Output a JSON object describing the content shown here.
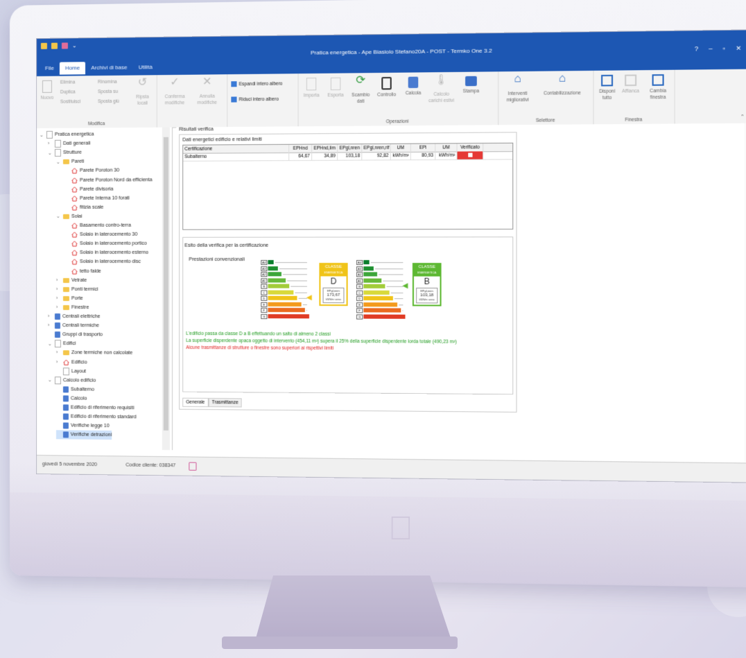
{
  "window": {
    "title": "Pratica energetica - Ape Biasiolo Stefano20A - POST - Termko One 3.2",
    "controls": [
      "?",
      "–",
      "▫",
      "✕"
    ]
  },
  "tabs": [
    "File",
    "Home",
    "Archivi di base",
    "Utilità"
  ],
  "ribbon": {
    "modifica": {
      "label": "Modifica",
      "nuovo": "Nuovo",
      "elimina": "Elimina",
      "duplica": "Duplica",
      "sostituisci": "Sostituisci",
      "rinomina": "Rinomina",
      "sposta_su": "Sposta su",
      "sposta_giu": "Sposta giù",
      "ripristina_locali": "Ripsta locali",
      "conferma_modifiche": "Conferma modifiche",
      "annulla_modifiche": "Annulla modifiche"
    },
    "albero": {
      "espandi": "Espandi intero albero",
      "riduci": "Riduci intero albero"
    },
    "operazioni": {
      "label": "Operazioni",
      "importa": "Importa",
      "esporta": "Esporta",
      "scambio_dati": "Scambio dati",
      "controllo": "Controllo",
      "calcola": "Calcola",
      "calcolo_carichi": "Calcolo carichi estivi",
      "stampa": "Stampa"
    },
    "selettore": {
      "label": "Selettore",
      "interventi": "Interventi migliorativi",
      "contabilizzazione": "Contabilizzazione"
    },
    "finestra": {
      "label": "Finestra",
      "disponi": "Disponi tutto",
      "affianca": "Affianca",
      "cambia": "Cambia finestra"
    }
  },
  "tree": [
    {
      "label": "Pratica energetica",
      "indent": 0,
      "icon": "doc",
      "chev": "v"
    },
    {
      "label": "Dati generali",
      "indent": 1,
      "icon": "doc",
      "chev": ">"
    },
    {
      "label": "Strutture",
      "indent": 1,
      "icon": "doc",
      "chev": "v"
    },
    {
      "label": "Pareti",
      "indent": 2,
      "icon": "folder",
      "chev": "v"
    },
    {
      "label": "Parete Poroton 30",
      "indent": 3,
      "icon": "house",
      "chev": ""
    },
    {
      "label": "Parete Poroton Nord da efficienta",
      "indent": 3,
      "icon": "house",
      "chev": ""
    },
    {
      "label": "Parete divisoria",
      "indent": 3,
      "icon": "house",
      "chev": ""
    },
    {
      "label": "Parete Interna 10 forati",
      "indent": 3,
      "icon": "house",
      "chev": ""
    },
    {
      "label": "fitizia scale",
      "indent": 3,
      "icon": "house",
      "chev": ""
    },
    {
      "label": "Solai",
      "indent": 2,
      "icon": "folder",
      "chev": "v"
    },
    {
      "label": "Basamento contro-terra",
      "indent": 3,
      "icon": "house",
      "chev": ""
    },
    {
      "label": "Solaio in laterocemento 30",
      "indent": 3,
      "icon": "house",
      "chev": ""
    },
    {
      "label": "Solaio in laterocemento portico",
      "indent": 3,
      "icon": "house",
      "chev": ""
    },
    {
      "label": "Solaio in laterocemento esterno",
      "indent": 3,
      "icon": "house",
      "chev": ""
    },
    {
      "label": "Solaio in laterocemento disc",
      "indent": 3,
      "icon": "house",
      "chev": ""
    },
    {
      "label": "tetto falde",
      "indent": 3,
      "icon": "house",
      "chev": ""
    },
    {
      "label": "Vetrate",
      "indent": 2,
      "icon": "folder",
      "chev": ">"
    },
    {
      "label": "Ponti termici",
      "indent": 2,
      "icon": "folder",
      "chev": ">"
    },
    {
      "label": "Porte",
      "indent": 2,
      "icon": "folder",
      "chev": ">"
    },
    {
      "label": "Finestre",
      "indent": 2,
      "icon": "folder",
      "chev": ">"
    },
    {
      "label": "Centrali elettriche",
      "indent": 1,
      "icon": "calc",
      "chev": ">"
    },
    {
      "label": "Centrali termiche",
      "indent": 1,
      "icon": "calc",
      "chev": ">"
    },
    {
      "label": "Gruppi di trasporto",
      "indent": 1,
      "icon": "calc",
      "chev": ""
    },
    {
      "label": "Edifici",
      "indent": 1,
      "icon": "doc",
      "chev": "v"
    },
    {
      "label": "Zone termiche non calcolate",
      "indent": 2,
      "icon": "folder",
      "chev": ">"
    },
    {
      "label": "Edificio",
      "indent": 2,
      "icon": "house",
      "chev": ">"
    },
    {
      "label": "Layout",
      "indent": 2,
      "icon": "doc",
      "chev": ""
    },
    {
      "label": "Calcolo edificio",
      "indent": 1,
      "icon": "doc",
      "chev": "v"
    },
    {
      "label": "Subalterno",
      "indent": 2,
      "icon": "calc",
      "chev": ""
    },
    {
      "label": "Calcolo",
      "indent": 2,
      "icon": "calc",
      "chev": ""
    },
    {
      "label": "Edificio di riferimento requisiti",
      "indent": 2,
      "icon": "calc",
      "chev": ""
    },
    {
      "label": "Edificio di riferimento standard",
      "indent": 2,
      "icon": "calc",
      "chev": ""
    },
    {
      "label": "Verifiche legge 10",
      "indent": 2,
      "icon": "calc",
      "chev": ""
    },
    {
      "label": "Verifiche detrazioni",
      "indent": 2,
      "icon": "calc",
      "chev": "",
      "selected": true
    }
  ],
  "status": {
    "date": "giovedì 5 novembre 2020",
    "client_code": "Codice cliente: 038347"
  },
  "results": {
    "title": "Risultati verifica",
    "section1": "Dati energetici edificio e relativi limiti",
    "headers": [
      "Certificazione",
      "EPHnd",
      "EPHnd,lim",
      "EPgl,nren",
      "EPgl,nren,rif",
      "UM",
      "EPi",
      "UM",
      "Verificato"
    ],
    "rows": [
      [
        "Subalterno",
        "64,67",
        "34,89",
        "103,18",
        "92,82",
        "kWh/m²",
        "80,93",
        "kWh/m²",
        ""
      ]
    ],
    "section2": "Esito della verifica per la certificazione",
    "prestazioni": "Prestazioni convenzionali",
    "class_before": {
      "header": "CLASSE",
      "sub": "ENERGETICA",
      "letter": "D",
      "label": "EPgl,nren",
      "value": "173,67",
      "unit": "kWh/m² anno"
    },
    "class_after": {
      "header": "CLASSE",
      "sub": "ENERGETICA",
      "letter": "B",
      "label": "EPgl,nren",
      "value": "103,18",
      "unit": "kWh/m² anno"
    },
    "scale_letters": [
      "A4",
      "A3",
      "A2",
      "A1",
      "B",
      "C",
      "D",
      "E",
      "F",
      "G"
    ],
    "messages": [
      {
        "text": "L'edificio passa da classe D a B effettuando un salto di almeno 2 classi",
        "color": "#1e9a1e"
      },
      {
        "text": "La superficie disperdente opaca oggetto di intervento (454,11 m²) supera il 25% della superficie disperdente lorda totale (490,23 m²)",
        "color": "#1e9a1e"
      },
      {
        "text": "Alcune trasmittanze di strutture o finestre sono superiori ai rispettivi limiti",
        "color": "#e02020"
      }
    ],
    "bottom_tabs": [
      "Generale",
      "Trasmittanze"
    ]
  },
  "colors": {
    "titlebar": "#1d57b3",
    "class_d": "#f0c419",
    "class_b": "#5db832",
    "fail": "#e53935"
  }
}
